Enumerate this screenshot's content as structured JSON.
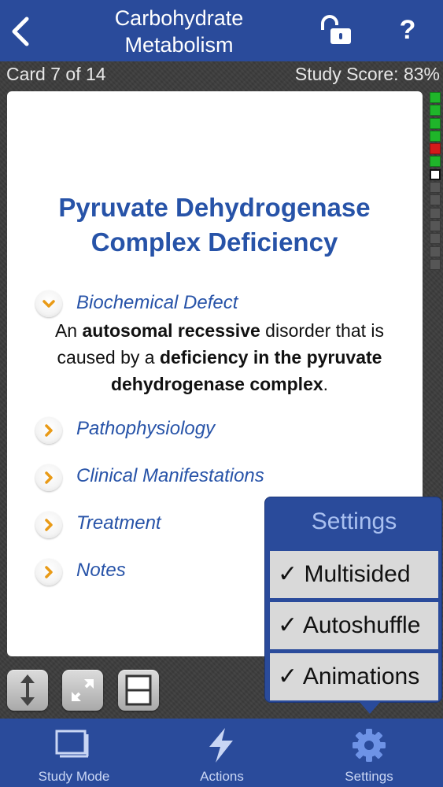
{
  "nav": {
    "title_line1": "Carbohydrate",
    "title_line2": "Metabolism",
    "help_label": "?",
    "back_icon": "chevron-left-icon",
    "lock_icon": "unlocked-padlock-icon"
  },
  "status": {
    "card_position": "Card 7 of 14",
    "study_score": "Study Score: 83%"
  },
  "card": {
    "title_line1": "Pyruvate Dehydrogenase",
    "title_line2": "Complex Deficiency",
    "sections": [
      {
        "label": "Biochemical Defect",
        "expanded": true
      },
      {
        "label": "Pathophysiology",
        "expanded": false
      },
      {
        "label": "Clinical Manifestations",
        "expanded": false
      },
      {
        "label": "Treatment",
        "expanded": false
      },
      {
        "label": "Notes",
        "expanded": false
      }
    ],
    "defect_text": {
      "p1": "An ",
      "b1": "autosomal recessive",
      "p2": " disorder that is caused by a ",
      "b2": "deficiency in the pyruvate dehydrogenase complex",
      "p3": "."
    }
  },
  "progress": {
    "cards": [
      "correct",
      "correct",
      "correct",
      "correct",
      "incorrect",
      "correct",
      "current",
      "none",
      "none",
      "none",
      "none",
      "none",
      "none",
      "none"
    ],
    "colors": {
      "correct": "#1fb52a",
      "incorrect": "#d51a1a",
      "current": "#ffffff",
      "none": "#565656"
    }
  },
  "tools": [
    {
      "name": "flip-vertical-icon"
    },
    {
      "name": "expand-icon"
    },
    {
      "name": "card-layout-icon"
    }
  ],
  "settings_popover": {
    "title": "Settings",
    "items": [
      "✓ Multisided",
      "✓ Autoshuffle",
      "✓ Animations"
    ]
  },
  "tabbar": {
    "tabs": [
      {
        "label": "Study Mode",
        "icon": "study-mode-icon"
      },
      {
        "label": "Actions",
        "icon": "lightning-icon"
      },
      {
        "label": "Settings",
        "icon": "gear-icon"
      }
    ]
  },
  "colors": {
    "brand_blue": "#2a4b9b",
    "title_blue": "#2753a8",
    "accent_orange": "#e99a16"
  }
}
